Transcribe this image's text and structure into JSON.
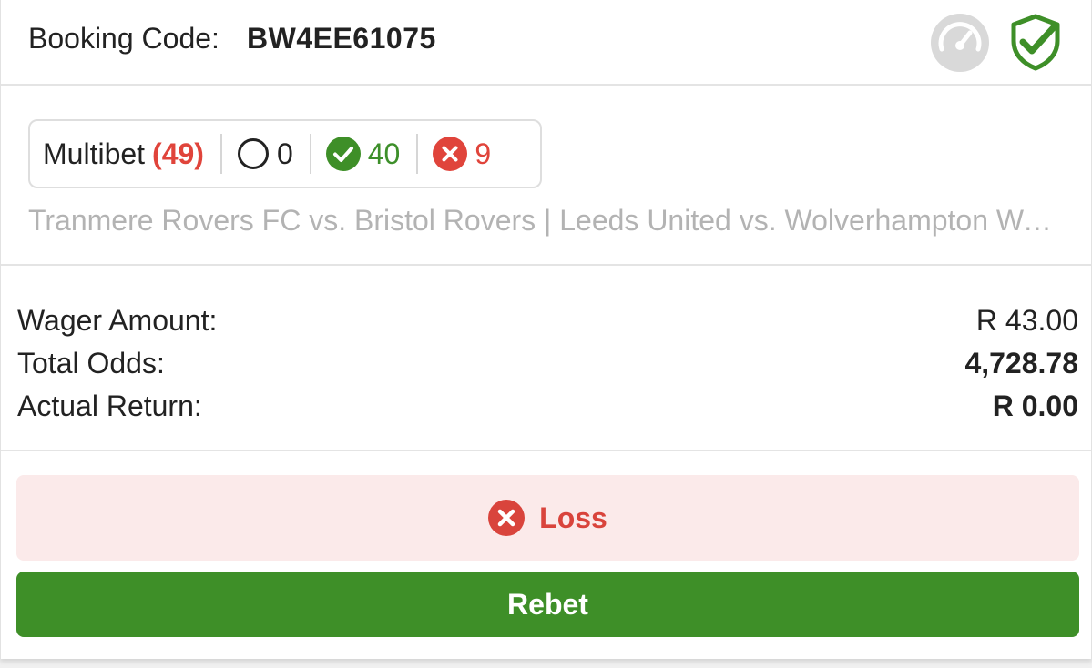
{
  "header": {
    "booking_label": "Booking Code:",
    "booking_code": "BW4EE61075",
    "icons": [
      "speedometer-icon",
      "shield-check-icon"
    ]
  },
  "bet_summary": {
    "type_label": "Multibet",
    "total": "(49)",
    "open_count": "0",
    "won_count": "40",
    "lost_count": "9",
    "matches_preview": "Tranmere Rovers FC vs. Bristol Rovers | Leeds United vs. Wolverhampton Wanderers"
  },
  "amounts": {
    "wager_label": "Wager Amount:",
    "wager_value": "R 43.00",
    "odds_label": "Total Odds:",
    "odds_value": "4,728.78",
    "return_label": "Actual Return:",
    "return_value": "R 0.00"
  },
  "result": {
    "status": "Loss"
  },
  "actions": {
    "rebet_label": "Rebet"
  },
  "colors": {
    "win_green": "#3e8f28",
    "loss_red": "#e0443b",
    "loss_bg": "#fbeaea",
    "muted_text": "#b3b3b3"
  }
}
